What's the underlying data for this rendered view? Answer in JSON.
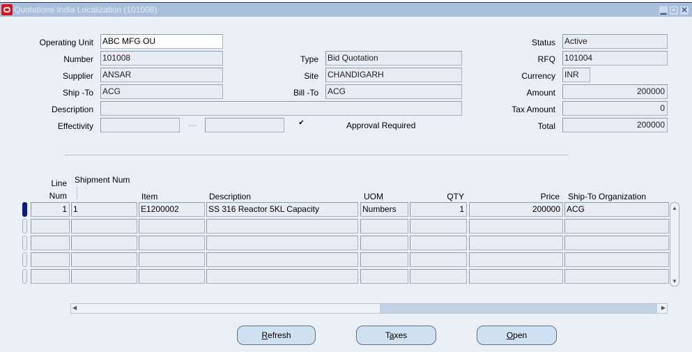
{
  "window": {
    "title": "Quotations India Localization (101008)",
    "controls": {
      "minimize": "▁",
      "maximize": "□",
      "close": "✕"
    }
  },
  "header": {
    "operating_unit": {
      "label": "Operating Unit",
      "value": "ABC MFG OU"
    },
    "number": {
      "label": "Number",
      "value": "101008"
    },
    "supplier": {
      "label": "Supplier",
      "value": "ANSAR"
    },
    "ship_to": {
      "label": "Ship -To",
      "value": "ACG"
    },
    "description": {
      "label": "Description",
      "value": ""
    },
    "effectivity": {
      "label": "Effectivity",
      "from": "",
      "to": "",
      "separator": "—"
    },
    "type": {
      "label": "Type",
      "value": "Bid Quotation"
    },
    "site": {
      "label": "Site",
      "value": "CHANDIGARH"
    },
    "bill_to": {
      "label": "Bill -To",
      "value": "ACG"
    },
    "approval_required": {
      "label": "Approval Required",
      "checked": true,
      "mark": "✔"
    },
    "status": {
      "label": "Status",
      "value": "Active"
    },
    "rfq": {
      "label": "RFQ",
      "value": "101004"
    },
    "currency": {
      "label": "Currency",
      "value": "INR"
    },
    "amount": {
      "label": "Amount",
      "value": "200000"
    },
    "tax_amount": {
      "label": "Tax Amount",
      "value": "0"
    },
    "total": {
      "label": "Total",
      "value": "200000"
    }
  },
  "lines": {
    "columns": {
      "line_num_1": "Line",
      "line_num_2": "Num",
      "shipment_num": "Shipment Num",
      "item": "Item",
      "description": "Description",
      "uom": "UOM",
      "qty": "QTY",
      "price": "Price",
      "ship_to_org": "Ship-To Organization"
    },
    "rows": [
      {
        "line_num": "1",
        "shipment_num": "1",
        "item": "E1200002",
        "description": "SS 316 Reactor 5KL Capacity",
        "uom": "Numbers",
        "qty": "1",
        "price": "200000",
        "ship_to_org": "ACG"
      },
      {
        "line_num": "",
        "shipment_num": "",
        "item": "",
        "description": "",
        "uom": "",
        "qty": "",
        "price": "",
        "ship_to_org": ""
      },
      {
        "line_num": "",
        "shipment_num": "",
        "item": "",
        "description": "",
        "uom": "",
        "qty": "",
        "price": "",
        "ship_to_org": ""
      },
      {
        "line_num": "",
        "shipment_num": "",
        "item": "",
        "description": "",
        "uom": "",
        "qty": "",
        "price": "",
        "ship_to_org": ""
      },
      {
        "line_num": "",
        "shipment_num": "",
        "item": "",
        "description": "",
        "uom": "",
        "qty": "",
        "price": "",
        "ship_to_org": ""
      }
    ]
  },
  "scroll": {
    "up": "▲",
    "down": "▼",
    "left": "◀",
    "right": "▶"
  },
  "buttons": {
    "refresh": {
      "mnemonic": "R",
      "rest": "efresh"
    },
    "taxes": {
      "pre": "T",
      "mnemonic": "a",
      "rest": "xes"
    },
    "open": {
      "mnemonic": "O",
      "rest": "pen"
    }
  }
}
